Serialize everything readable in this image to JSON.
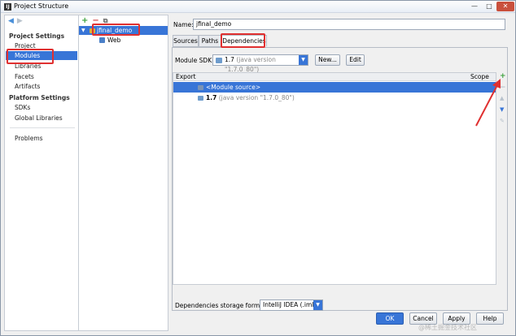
{
  "window": {
    "title": "Project Structure",
    "app_icon": "IJ",
    "minimize": "—",
    "maximize": "□",
    "close": "✕"
  },
  "nav": {
    "back_icon": "◀",
    "forward_icon": "▶",
    "project_settings_head": "Project Settings",
    "project_settings": [
      "Project",
      "Modules",
      "Libraries",
      "Facets",
      "Artifacts"
    ],
    "platform_settings_head": "Platform Settings",
    "platform_settings": [
      "SDKs",
      "Global Libraries"
    ],
    "problems": "Problems",
    "selected": "Modules"
  },
  "tree": {
    "add": "+",
    "remove": "−",
    "copy": "⧉",
    "module": "jfinal_demo",
    "facet": "Web",
    "expand_icon": "▼"
  },
  "module": {
    "name_label": "Name:",
    "name_value": "jfinal_demo",
    "tabs": [
      "Sources",
      "Paths",
      "Dependencies"
    ],
    "active_tab": "Dependencies",
    "sdk_label": "Module SDK:",
    "sdk_value": "1.7",
    "sdk_detail": "(java version \"1.7.0_80\")",
    "sdk_drop": "▼",
    "new_button": "New...",
    "edit_button": "Edit"
  },
  "dependencies": {
    "col_export": "Export",
    "col_scope": "Scope",
    "rows": [
      {
        "label": "<Module source>",
        "detail": ""
      },
      {
        "label": "1.7",
        "detail": "(java version \"1.7.0_80\")"
      }
    ],
    "tools": {
      "add": "+",
      "remove": "−",
      "up": "▲",
      "down": "▼",
      "edit": "✎"
    }
  },
  "storage": {
    "label": "Dependencies storage format:",
    "value": "IntelliJ IDEA (.iml)",
    "drop": "▼"
  },
  "footer": {
    "ok": "OK",
    "cancel": "Cancel",
    "apply": "Apply",
    "help": "Help"
  },
  "colors": {
    "selection": "#3875d7",
    "annotation": "#e03030",
    "add_green": "#3aa13a"
  },
  "watermark": "@稀土掘金技术社区"
}
